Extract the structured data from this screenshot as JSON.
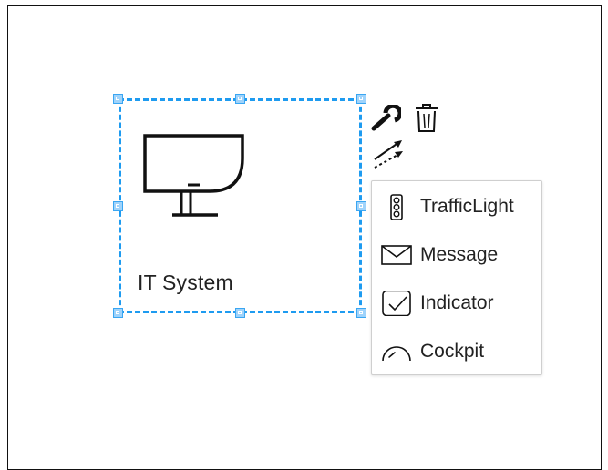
{
  "node": {
    "label": "IT System",
    "icon": "monitor-icon"
  },
  "toolbar": {
    "edit_icon": "wrench-icon",
    "delete_icon": "trash-icon",
    "connect_icon": "connector-arrows-icon"
  },
  "menu": {
    "items": [
      {
        "label": "TrafficLight",
        "icon": "traffic-light-icon"
      },
      {
        "label": "Message",
        "icon": "envelope-icon"
      },
      {
        "label": "Indicator",
        "icon": "checkbox-icon"
      },
      {
        "label": "Cockpit",
        "icon": "gauge-icon"
      }
    ]
  },
  "colors": {
    "selection": "#1e9bf0",
    "handle_fill": "#9fd3fb",
    "text": "#222222"
  }
}
